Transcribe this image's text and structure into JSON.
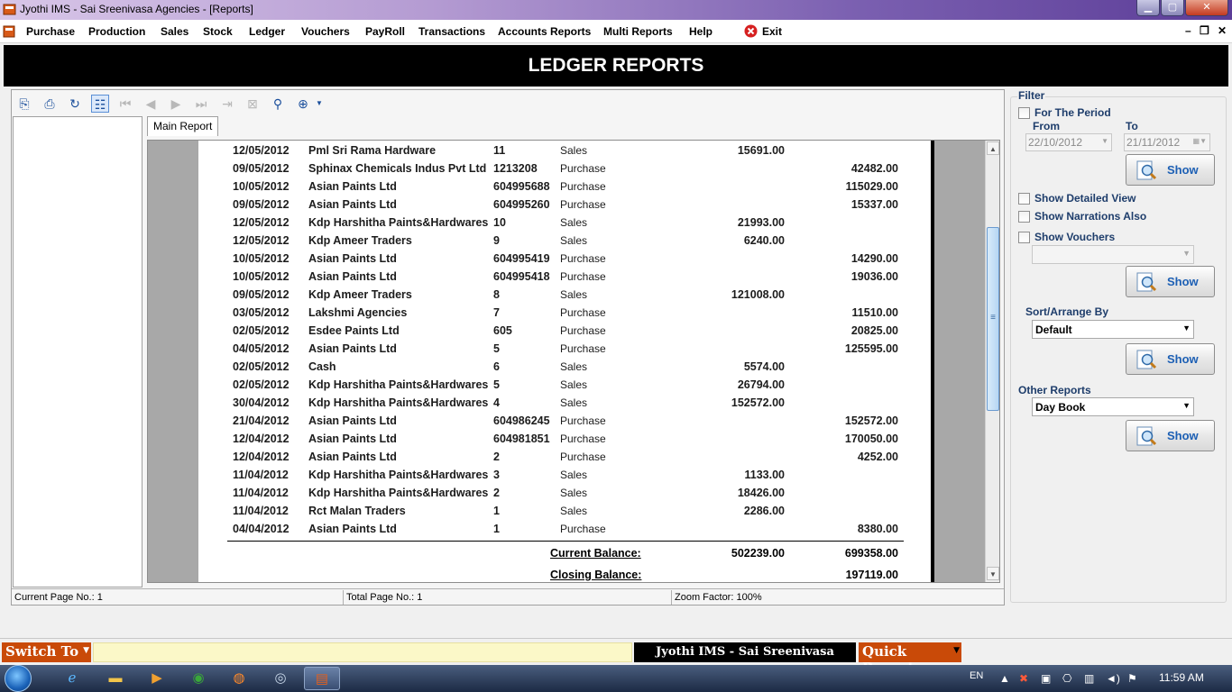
{
  "window": {
    "title": "Jyothi IMS - Sai Sreenivasa Agencies - [Reports]",
    "minimize": "▁",
    "maximize": "▢",
    "close": "✕"
  },
  "menu": {
    "items": [
      "Purchase",
      "Production",
      "Sales",
      "Stock",
      "Ledger",
      "Vouchers",
      "PayRoll",
      "Transactions",
      "Accounts Reports",
      "Multi Reports",
      "Help",
      "Exit"
    ],
    "mdi_min": "–",
    "mdi_restore": "❐",
    "mdi_close": "✕"
  },
  "banner": {
    "title": "LEDGER REPORTS"
  },
  "viewer": {
    "tab": "Main Report",
    "status": {
      "current_page": "Current Page No.: 1",
      "total_page": "Total Page No.: 1",
      "zoom": "Zoom Factor: 100%"
    }
  },
  "report": {
    "rows": [
      {
        "date": "12/05/2012",
        "party": "Pml Sri Rama Hardware",
        "no": "11",
        "type": "Sales",
        "debit": "15691.00",
        "credit": ""
      },
      {
        "date": "09/05/2012",
        "party": "Sphinax Chemicals Indus Pvt Ltd",
        "no": "1213208",
        "type": "Purchase",
        "debit": "",
        "credit": "42482.00"
      },
      {
        "date": "10/05/2012",
        "party": "Asian Paints Ltd",
        "no": "604995688",
        "type": "Purchase",
        "debit": "",
        "credit": "115029.00"
      },
      {
        "date": "09/05/2012",
        "party": "Asian Paints Ltd",
        "no": "604995260",
        "type": "Purchase",
        "debit": "",
        "credit": "15337.00"
      },
      {
        "date": "12/05/2012",
        "party": "Kdp Harshitha Paints&Hardwares",
        "no": "10",
        "type": "Sales",
        "debit": "21993.00",
        "credit": ""
      },
      {
        "date": "12/05/2012",
        "party": "Kdp Ameer Traders",
        "no": "9",
        "type": "Sales",
        "debit": "6240.00",
        "credit": ""
      },
      {
        "date": "10/05/2012",
        "party": "Asian Paints Ltd",
        "no": "604995419",
        "type": "Purchase",
        "debit": "",
        "credit": "14290.00"
      },
      {
        "date": "10/05/2012",
        "party": "Asian Paints Ltd",
        "no": "604995418",
        "type": "Purchase",
        "debit": "",
        "credit": "19036.00"
      },
      {
        "date": "09/05/2012",
        "party": "Kdp Ameer Traders",
        "no": "8",
        "type": "Sales",
        "debit": "121008.00",
        "credit": ""
      },
      {
        "date": "03/05/2012",
        "party": "Lakshmi Agencies",
        "no": "7",
        "type": "Purchase",
        "debit": "",
        "credit": "11510.00"
      },
      {
        "date": "02/05/2012",
        "party": "Esdee Paints Ltd",
        "no": "605",
        "type": "Purchase",
        "debit": "",
        "credit": "20825.00"
      },
      {
        "date": "04/05/2012",
        "party": "Asian Paints Ltd",
        "no": "5",
        "type": "Purchase",
        "debit": "",
        "credit": "125595.00"
      },
      {
        "date": "02/05/2012",
        "party": "Cash",
        "no": "6",
        "type": "Sales",
        "debit": "5574.00",
        "credit": ""
      },
      {
        "date": "02/05/2012",
        "party": "Kdp Harshitha Paints&Hardwares",
        "no": "5",
        "type": "Sales",
        "debit": "26794.00",
        "credit": ""
      },
      {
        "date": "30/04/2012",
        "party": "Kdp Harshitha Paints&Hardwares",
        "no": "4",
        "type": "Sales",
        "debit": "152572.00",
        "credit": ""
      },
      {
        "date": "21/04/2012",
        "party": "Asian Paints Ltd",
        "no": "604986245",
        "type": "Purchase",
        "debit": "",
        "credit": "152572.00"
      },
      {
        "date": "12/04/2012",
        "party": "Asian Paints Ltd",
        "no": "604981851",
        "type": "Purchase",
        "debit": "",
        "credit": "170050.00"
      },
      {
        "date": "12/04/2012",
        "party": "Asian Paints Ltd",
        "no": "2",
        "type": "Purchase",
        "debit": "",
        "credit": "4252.00"
      },
      {
        "date": "11/04/2012",
        "party": "Kdp Harshitha Paints&Hardwares",
        "no": "3",
        "type": "Sales",
        "debit": "1133.00",
        "credit": ""
      },
      {
        "date": "11/04/2012",
        "party": "Kdp Harshitha Paints&Hardwares",
        "no": "2",
        "type": "Sales",
        "debit": "18426.00",
        "credit": ""
      },
      {
        "date": "11/04/2012",
        "party": "Rct Malan Traders",
        "no": "1",
        "type": "Sales",
        "debit": "2286.00",
        "credit": ""
      },
      {
        "date": "04/04/2012",
        "party": "Asian Paints Ltd",
        "no": "1",
        "type": "Purchase",
        "debit": "",
        "credit": "8380.00"
      }
    ],
    "current_balance": {
      "label": "Current Balance:",
      "debit": "502239.00",
      "credit": "699358.00"
    },
    "closing_balance": {
      "label": "Closing Balance:",
      "credit": "197119.00"
    }
  },
  "filter": {
    "legend": "Filter",
    "for_the_period": "For The Period",
    "from_label": "From",
    "to_label": "To",
    "from_date": "22/10/2012",
    "to_date": "21/11/2012",
    "show_label": "Show",
    "show_detailed_view": "Show Detailed View",
    "show_narrations_also": "Show Narrations Also",
    "show_vouchers": "Show Vouchers",
    "sort_label": "Sort/Arrange By",
    "sort_value": "Default",
    "other_reports_label": "Other Reports",
    "other_reports_value": "Day Book"
  },
  "bottom": {
    "switch_to": "Switch To",
    "app_label": "Jyothi IMS - Sai Sreenivasa Agencies",
    "quick_report": "Quick Report"
  },
  "taskbar": {
    "language": "EN",
    "clock": "11:59 AM"
  }
}
